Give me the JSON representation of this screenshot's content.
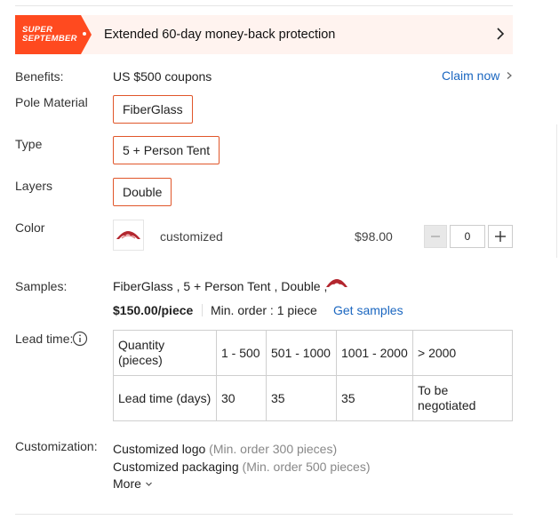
{
  "banner": {
    "tag_line1": "SUPER",
    "tag_line2": "SEPTEMBER",
    "text": "Extended 60-day money-back protection",
    "icon": "chevron-right-icon",
    "tag_color": "#ff4a1f"
  },
  "benefits": {
    "label": "Benefits:",
    "value": "US $500 coupons",
    "claim_label": "Claim now"
  },
  "pole_material": {
    "label": "Pole Material",
    "option": "FiberGlass"
  },
  "type": {
    "label": "Type",
    "option": "5 + Person Tent"
  },
  "layers": {
    "label": "Layers",
    "option": "Double"
  },
  "color": {
    "label": "Color",
    "name": "customized",
    "price": "$98.00",
    "quantity": "0"
  },
  "samples": {
    "label": "Samples:",
    "selection": "FiberGlass , 5 + Person Tent , Double ,",
    "price": "$150.00/piece",
    "min_order": "Min. order : 1 piece",
    "cta": "Get samples"
  },
  "lead_time": {
    "label": "Lead time:",
    "header_label": "Quantity (pieces)",
    "ranges": [
      "1 - 500",
      "501 - 1000",
      "1001 - 2000",
      "> 2000"
    ],
    "row_label": "Lead time (days)",
    "days": [
      "30",
      "35",
      "35",
      "To be negotiated"
    ]
  },
  "customization": {
    "label": "Customization:",
    "items": [
      {
        "name": "Customized logo",
        "note": "(Min. order 300 pieces)"
      },
      {
        "name": "Customized packaging",
        "note": "(Min. order 500 pieces)"
      }
    ],
    "more_label": "More"
  }
}
